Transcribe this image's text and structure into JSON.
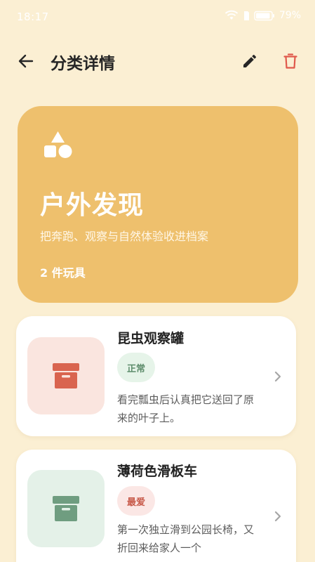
{
  "status_bar": {
    "time": "18:17",
    "battery": "79%"
  },
  "app_bar": {
    "title": "分类详情",
    "icons": [
      "back-arrow-icon",
      "edit-pencil-icon",
      "trash-icon"
    ]
  },
  "category": {
    "title": "户外发现",
    "description": "把奔跑、观察与自然体验收进档案",
    "count": "2 件玩具",
    "color": "#eec06d",
    "icon": "shapes-icon"
  },
  "toys": [
    {
      "name": "昆虫观察罐",
      "status": "正常",
      "note": "看完瓢虫后认真把它送回了原来的叶子上。",
      "thumb_color": "#fae5df",
      "icon_color": "#d9644f",
      "icon": "box-icon"
    },
    {
      "name": "薄荷色滑板车",
      "status": "最爱",
      "note": "第一次独立滑到公园长椅，又折回来给家人一个",
      "thumb_color": "#e4f1e8",
      "icon_color": "#6f9d80",
      "icon": "box-icon"
    }
  ],
  "colors": {
    "background": "#fbefd3",
    "delete": "#e0594b"
  }
}
